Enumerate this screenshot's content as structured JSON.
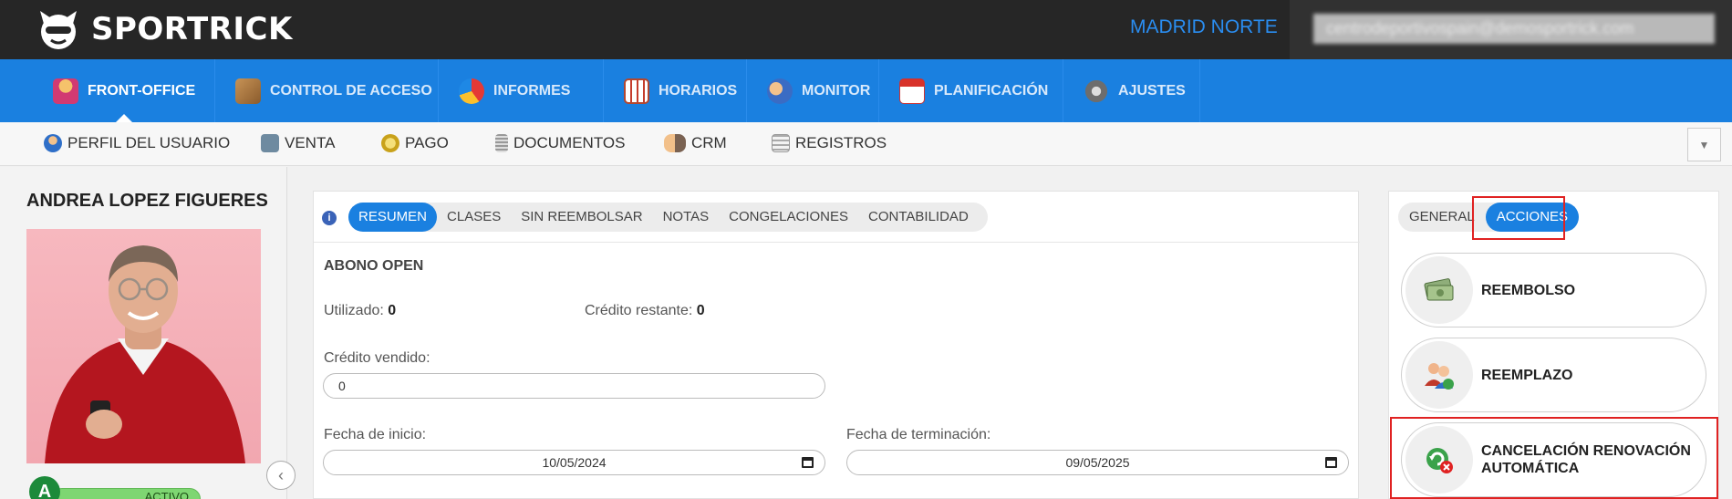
{
  "app": {
    "brand": "SPORTRICK",
    "center_name": "MADRID NORTE",
    "user_email": "centrodeportivospain@demosportrick.com"
  },
  "main_nav": [
    {
      "label": "FRONT-OFFICE",
      "icon": "front-office-icon",
      "active": true
    },
    {
      "label": "CONTROL DE ACCESO",
      "icon": "access-control-icon"
    },
    {
      "label": "INFORMES",
      "icon": "reports-pie-icon"
    },
    {
      "label": "HORARIOS",
      "icon": "schedule-calendar-icon"
    },
    {
      "label": "MONITOR",
      "icon": "monitor-users-icon"
    },
    {
      "label": "PLANIFICACIÓN",
      "icon": "planning-calendar-icon"
    },
    {
      "label": "AJUSTES",
      "icon": "settings-gear-icon"
    }
  ],
  "sub_nav": [
    {
      "label": "PERFIL DEL USUARIO",
      "icon": "user-profile-icon"
    },
    {
      "label": "VENTA",
      "icon": "sale-icon"
    },
    {
      "label": "PAGO",
      "icon": "payment-coin-icon"
    },
    {
      "label": "DOCUMENTOS",
      "icon": "documents-icon"
    },
    {
      "label": "CRM",
      "icon": "crm-handshake-icon"
    },
    {
      "label": "REGISTROS",
      "icon": "records-icon"
    }
  ],
  "profile": {
    "name": "ANDREA LOPEZ FIGUERES",
    "level": "A",
    "status": "ACTIVO"
  },
  "center_tabs": [
    "RESUMEN",
    "CLASES",
    "SIN REEMBOLSAR",
    "NOTAS",
    "CONGELACIONES",
    "CONTABILIDAD"
  ],
  "summary": {
    "title": "ABONO OPEN",
    "used_label": "Utilizado:",
    "used_value": "0",
    "remaining_label": "Crédito restante:",
    "remaining_value": "0",
    "sold_label": "Crédito vendido:",
    "sold_value": "0",
    "start_label": "Fecha de inicio:",
    "start_value": "10/05/2024",
    "end_label": "Fecha de terminación:",
    "end_value": "09/05/2025"
  },
  "right_tabs": [
    "GENERAL",
    "ACCIONES"
  ],
  "actions": [
    {
      "label": "REEMBOLSO",
      "icon": "refund-money-icon"
    },
    {
      "label": "REEMPLAZO",
      "icon": "replace-users-icon"
    },
    {
      "label": "CANCELACIÓN RENOVACIÓN AUTOMÁTICA",
      "icon": "cancel-renewal-icon"
    }
  ],
  "colors": {
    "topbar": "#262626",
    "nav_blue": "#1a80e0",
    "highlight_red": "#e02222",
    "status_green": "#7ed672"
  }
}
